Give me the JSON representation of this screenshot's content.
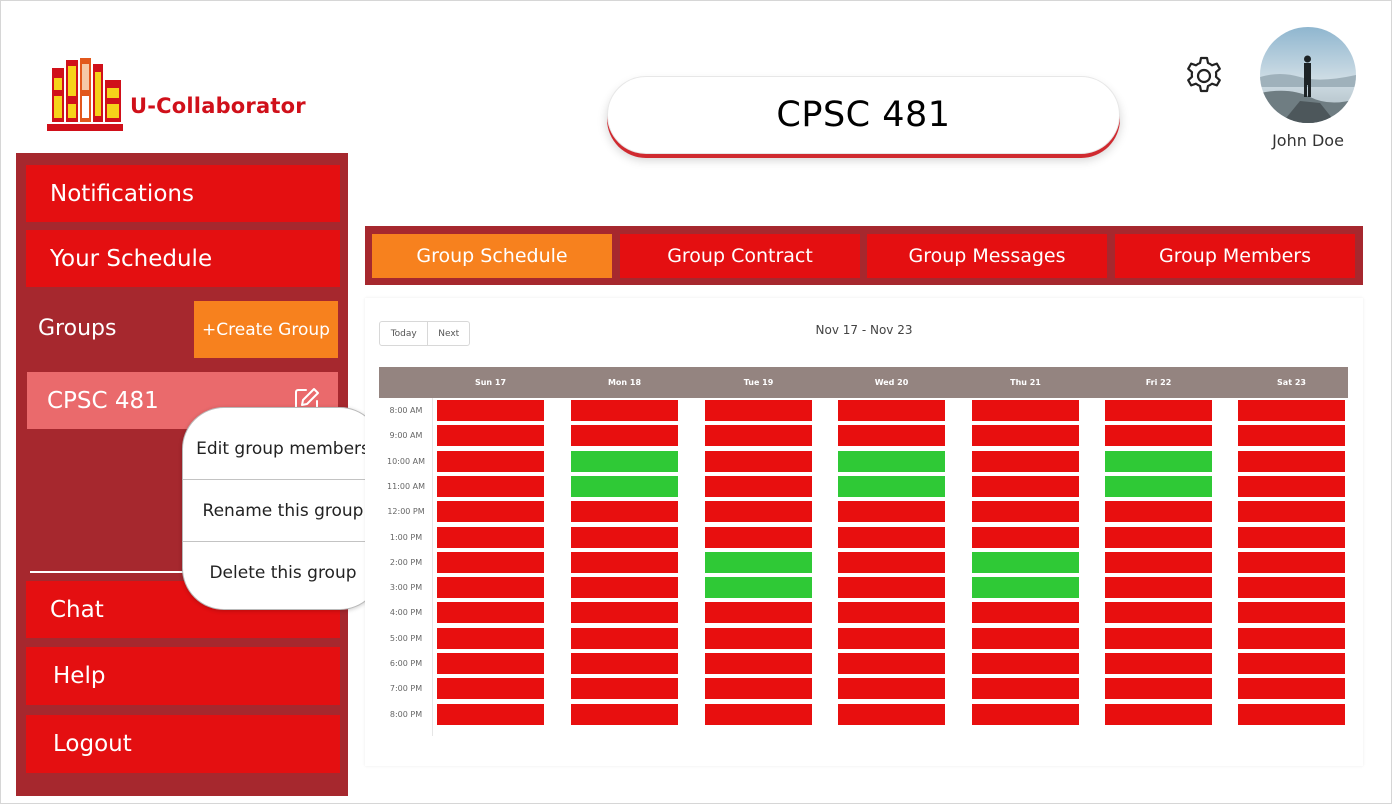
{
  "app": {
    "name": "U-Collaborator",
    "accent": "#e40f11",
    "accent_dark": "#a6282e",
    "highlight": "#f7811e"
  },
  "header": {
    "title": "CPSC 481",
    "user_name": "John Doe",
    "settings_icon": "gear-icon"
  },
  "sidebar": {
    "notifications": "Notifications",
    "your_schedule": "Your Schedule",
    "groups_label": "Groups",
    "create_group": "+Create Group",
    "group_name": "CPSC 481",
    "chat": "Chat",
    "help": "Help",
    "logout": "Logout"
  },
  "context_menu": {
    "items": [
      "Edit group members",
      "Rename this group",
      "Delete this group"
    ]
  },
  "tabs": {
    "items": [
      "Group Schedule",
      "Group Contract",
      "Group Messages",
      "Group Members"
    ],
    "active": "Group Schedule"
  },
  "calendar": {
    "today_label": "Today",
    "next_label": "Next",
    "range": "Nov 17 - Nov 23",
    "days": [
      "Sun 17",
      "Mon 18",
      "Tue 19",
      "Wed 20",
      "Thu 21",
      "Fri 22",
      "Sat 23"
    ],
    "times": [
      "8:00 AM",
      "9:00 AM",
      "10:00 AM",
      "11:00 AM",
      "12:00 PM",
      "1:00 PM",
      "2:00 PM",
      "3:00 PM",
      "4:00 PM",
      "5:00 PM",
      "6:00 PM",
      "7:00 PM",
      "8:00 PM"
    ],
    "busy_color": "#e80f0f",
    "free_color": "#2fc936",
    "availability": [
      [
        "busy",
        "busy",
        "busy",
        "busy",
        "busy",
        "busy",
        "busy"
      ],
      [
        "busy",
        "busy",
        "busy",
        "busy",
        "busy",
        "busy",
        "busy"
      ],
      [
        "busy",
        "free",
        "busy",
        "free",
        "busy",
        "free",
        "busy"
      ],
      [
        "busy",
        "free",
        "busy",
        "free",
        "busy",
        "free",
        "busy"
      ],
      [
        "busy",
        "busy",
        "busy",
        "busy",
        "busy",
        "busy",
        "busy"
      ],
      [
        "busy",
        "busy",
        "busy",
        "busy",
        "busy",
        "busy",
        "busy"
      ],
      [
        "busy",
        "busy",
        "free",
        "busy",
        "free",
        "busy",
        "busy"
      ],
      [
        "busy",
        "busy",
        "free",
        "busy",
        "free",
        "busy",
        "busy"
      ],
      [
        "busy",
        "busy",
        "busy",
        "busy",
        "busy",
        "busy",
        "busy"
      ],
      [
        "busy",
        "busy",
        "busy",
        "busy",
        "busy",
        "busy",
        "busy"
      ],
      [
        "busy",
        "busy",
        "busy",
        "busy",
        "busy",
        "busy",
        "busy"
      ],
      [
        "busy",
        "busy",
        "busy",
        "busy",
        "busy",
        "busy",
        "busy"
      ],
      [
        "busy",
        "busy",
        "busy",
        "busy",
        "busy",
        "busy",
        "busy"
      ]
    ]
  }
}
